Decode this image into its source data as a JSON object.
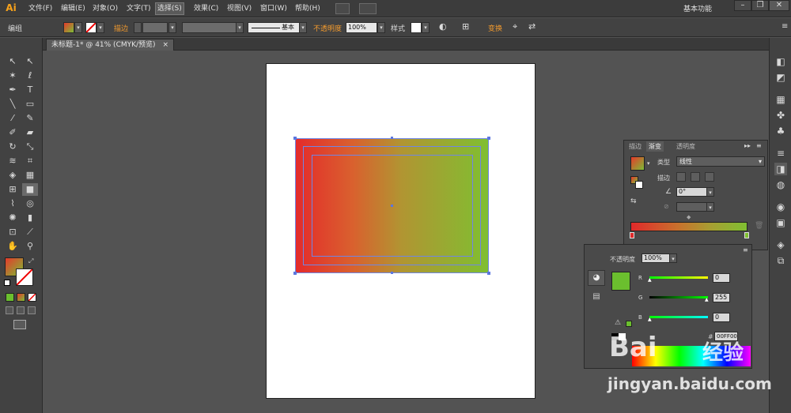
{
  "app": {
    "logo": "Ai",
    "workspace": "基本功能"
  },
  "menu": [
    "文件(F)",
    "编辑(E)",
    "对象(O)",
    "文字(T)",
    "选择(S)",
    "效果(C)",
    "视图(V)",
    "窗口(W)",
    "帮助(H)"
  ],
  "menu_active_index": 4,
  "controlbar": {
    "selection_label": "编组",
    "stroke_label": "描边",
    "stroke_style": "基本",
    "opacity_label": "不透明度",
    "opacity_value": "100%",
    "style_label": "样式",
    "transform_label": "变换"
  },
  "document": {
    "tab_title": "未标题-1* @ 41% (CMYK/预览)",
    "close_glyph": "×"
  },
  "gradient_panel": {
    "tabs": [
      "描边",
      "渐变",
      "透明度"
    ],
    "active_tab": 1,
    "type_label": "类型",
    "type_value": "线性",
    "stroke_label": "描边",
    "angle_value": "0°",
    "start_color": "#e02a2b",
    "end_color": "#7fbf31"
  },
  "color_panel": {
    "opacity_label": "不透明度",
    "opacity_value": "100%",
    "channels": [
      {
        "label": "R",
        "value": "0"
      },
      {
        "label": "G",
        "value": "255"
      },
      {
        "label": "B",
        "value": "0"
      }
    ],
    "hex_value": "00FF00",
    "hex_prefix": "#",
    "swatch_color": "#6bbf2e"
  },
  "watermark": {
    "brand": "Bai",
    "brand_suffix": "经验",
    "url": "jingyan.baidu.com"
  }
}
